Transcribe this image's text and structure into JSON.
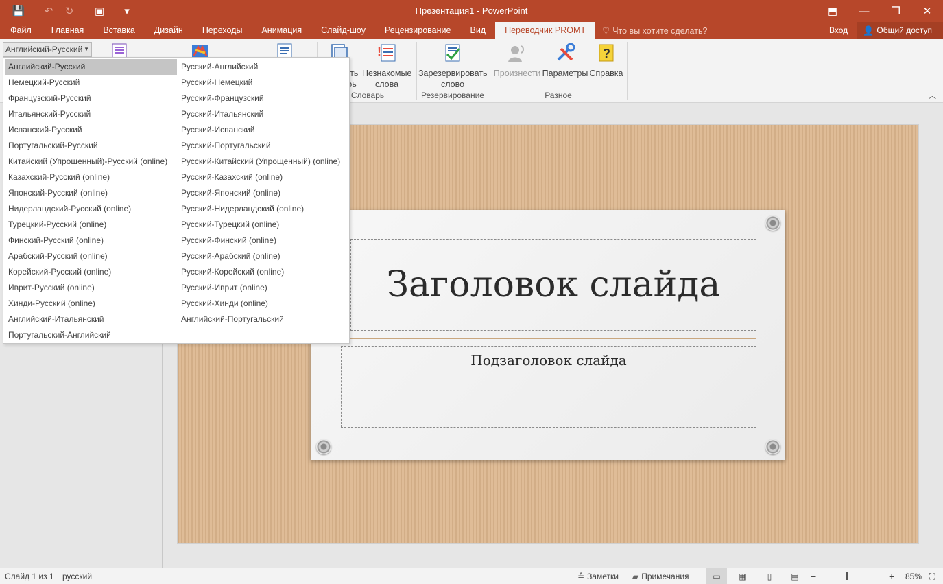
{
  "window": {
    "title": "Презентация1 - PowerPoint"
  },
  "qat": {
    "save_icon": "💾",
    "undo_icon": "↶",
    "redo_icon": "↻",
    "slideshow_icon": "▣",
    "customize_icon": "▾"
  },
  "window_controls": {
    "ribbon_display_icon": "⬒",
    "minimize_icon": "—",
    "restore_icon": "❐",
    "close_icon": "✕"
  },
  "tabs": [
    "Файл",
    "Главная",
    "Вставка",
    "Дизайн",
    "Переходы",
    "Анимация",
    "Слайд-шоу",
    "Рецензирование",
    "Вид",
    "Переводчик PROMT"
  ],
  "active_tab": "Переводчик PROMT",
  "tell_me": "Что вы хотите сделать?",
  "login": "Вход",
  "share": "Общий доступ",
  "ribbon": {
    "direction_value": "Английский-Русский",
    "buttons": {
      "add_line1": "ать",
      "add_line2": "рь",
      "unknown_line1": "Незнакомые",
      "unknown_line2": "слова",
      "reserve_line1": "Зарезервировать",
      "reserve_line2": "слово",
      "pronounce": "Произнести",
      "params": "Параметры",
      "help": "Справка"
    },
    "groups": {
      "dictionary": "Словарь",
      "reserve": "Резервирование",
      "misc": "Разное"
    }
  },
  "dropdown": {
    "left": [
      "Английский-Русский",
      "Немецкий-Русский",
      "Французский-Русский",
      "Итальянский-Русский",
      "Испанский-Русский",
      "Португальский-Русский",
      "Китайский (Упрощенный)-Русский (online)",
      "Казахский-Русский (online)",
      "Японский-Русский (online)",
      "Нидерландский-Русский (online)",
      "Турецкий-Русский (online)",
      "Финский-Русский (online)",
      "Арабский-Русский (online)",
      "Корейский-Русский (online)",
      "Иврит-Русский (online)",
      "Хинди-Русский (online)",
      "Английский-Итальянский",
      "Португальский-Английский"
    ],
    "right": [
      "Русский-Английский",
      "Русский-Немецкий",
      "Русский-Французский",
      "Русский-Итальянский",
      "Русский-Испанский",
      "Русский-Португальский",
      "Русский-Китайский (Упрощенный) (online)",
      "Русский-Казахский (online)",
      "Русский-Японский (online)",
      "Русский-Нидерландский (online)",
      "Русский-Турецкий (online)",
      "Русский-Финский (online)",
      "Русский-Арабский (online)",
      "Русский-Корейский (online)",
      "Русский-Иврит (online)",
      "Русский-Хинди (online)",
      "Английский-Португальский"
    ],
    "selected": "Английский-Русский"
  },
  "slide": {
    "title": "Заголовок слайда",
    "subtitle": "Подзаголовок слайда"
  },
  "status": {
    "slide_counter": "Слайд 1 из 1",
    "language": "русский",
    "notes": "Заметки",
    "comments": "Примечания",
    "zoom_minus": "−",
    "zoom_plus": "+",
    "zoom": "85%",
    "zoom_level": 0.85,
    "view_normal_icon": "▭",
    "view_sorter_icon": "▦",
    "view_reading_icon": "▯",
    "view_slideshow_icon": "▤",
    "fit_icon": "⛶"
  },
  "colors": {
    "accent": "#b7472a",
    "ribbon_bg": "#f3f3f3",
    "selected_option": "#c5c5c5"
  }
}
